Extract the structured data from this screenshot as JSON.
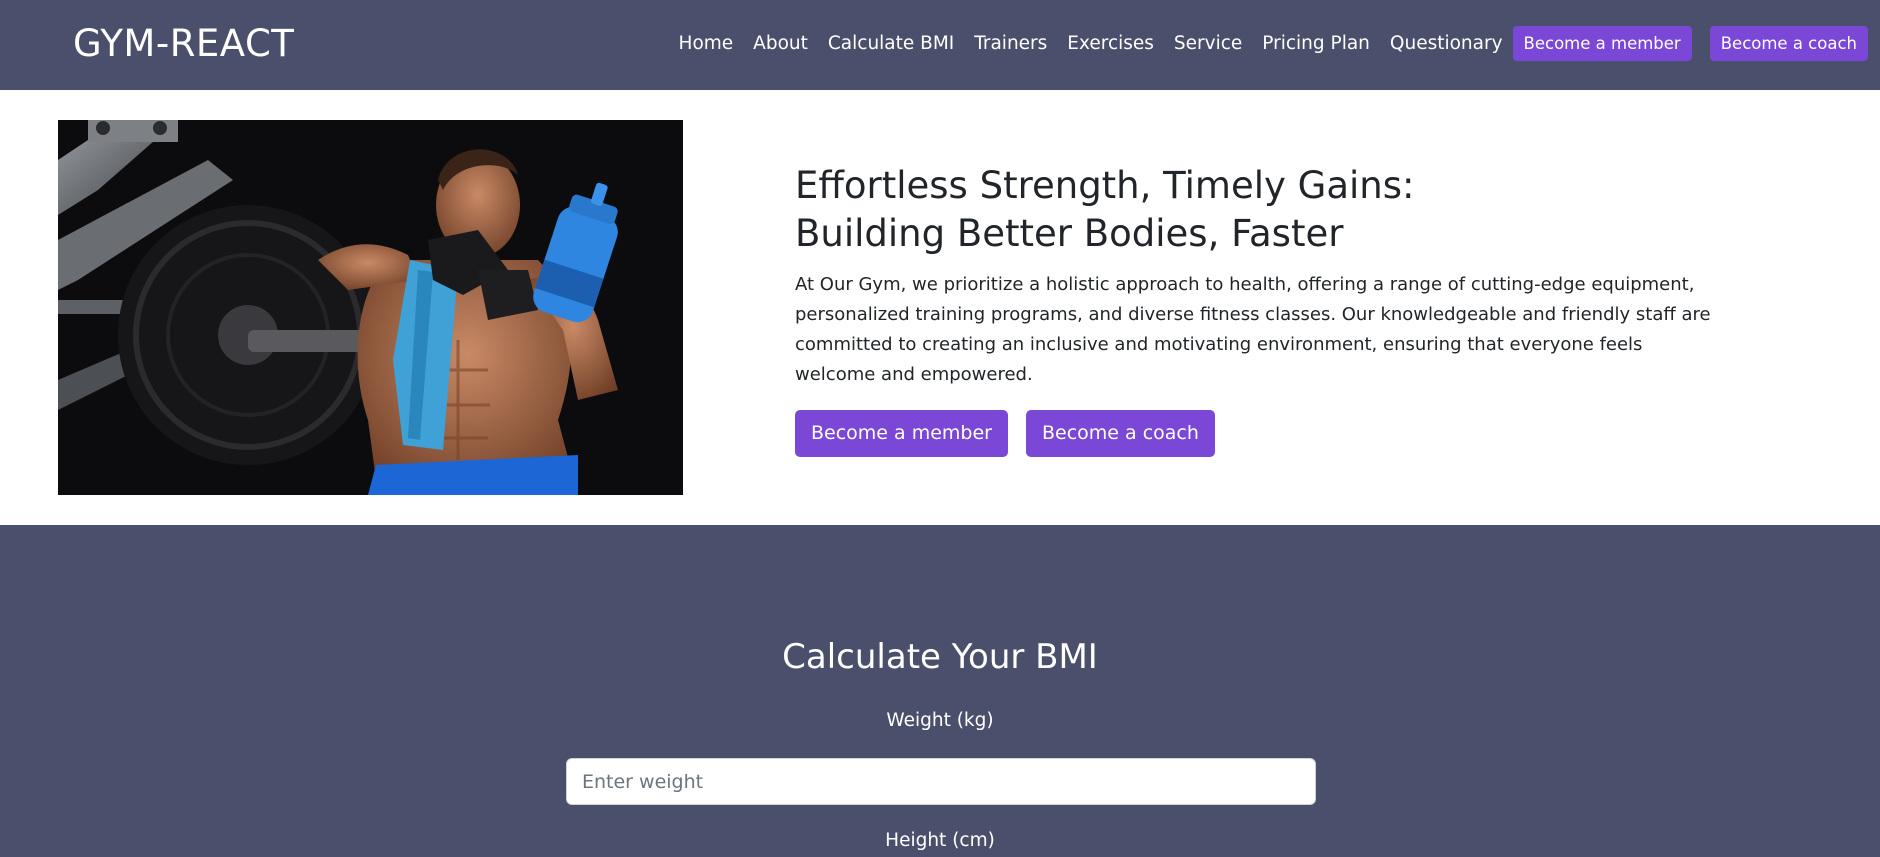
{
  "navbar": {
    "brand": "GYM-REACT",
    "links": [
      "Home",
      "About",
      "Calculate BMI",
      "Trainers",
      "Exercises",
      "Service",
      "Pricing Plan",
      "Questionary"
    ],
    "member_button": "Become a member",
    "coach_button": "Become a coach",
    "background_color": "#4a4f6c",
    "accent_color": "#7b47d6"
  },
  "hero": {
    "title": "Effortless Strength, Timely Gains:\nBuilding Better Bodies, Faster",
    "description": "At Our Gym, we prioritize a holistic approach to health, offering a range of cutting-edge equipment, personalized training programs, and diverse fitness classes. Our knowledgeable and friendly staff are committed to creating an inclusive and motivating environment, ensuring that everyone feels welcome and empowered.",
    "member_button": "Become a member",
    "coach_button": "Become a coach",
    "image_icon": "athlete-photo"
  },
  "bmi": {
    "title": "Calculate Your BMI",
    "weight_label": "Weight (kg)",
    "weight_placeholder": "Enter weight",
    "weight_value": "",
    "height_label": "Height (cm)"
  }
}
